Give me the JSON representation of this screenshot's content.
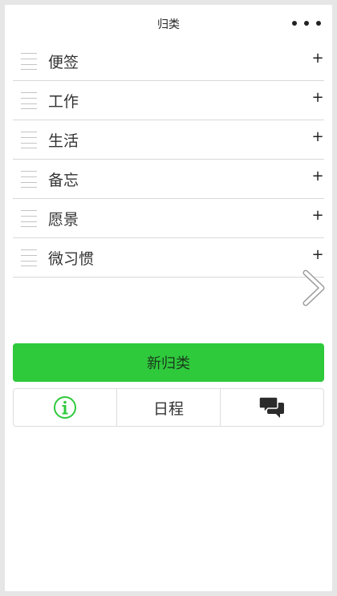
{
  "nav": {
    "title": "归类",
    "more_icon": "ellipsis-icon"
  },
  "categories": [
    {
      "label": "便签",
      "action": "+"
    },
    {
      "label": "工作",
      "action": "+"
    },
    {
      "label": "生活",
      "action": "+"
    },
    {
      "label": "备忘",
      "action": "+"
    },
    {
      "label": "愿景",
      "action": "+"
    },
    {
      "label": "微习惯",
      "action": "+"
    }
  ],
  "actions": {
    "new_category_label": "新归类"
  },
  "tabbar": {
    "info_icon": "info-circle-icon",
    "schedule_label": "日程",
    "chat_icon": "chat-bubbles-icon"
  },
  "colors": {
    "accent_green": "#2fc93c",
    "background": "#e6e6e6",
    "divider": "#d9d9d9"
  }
}
